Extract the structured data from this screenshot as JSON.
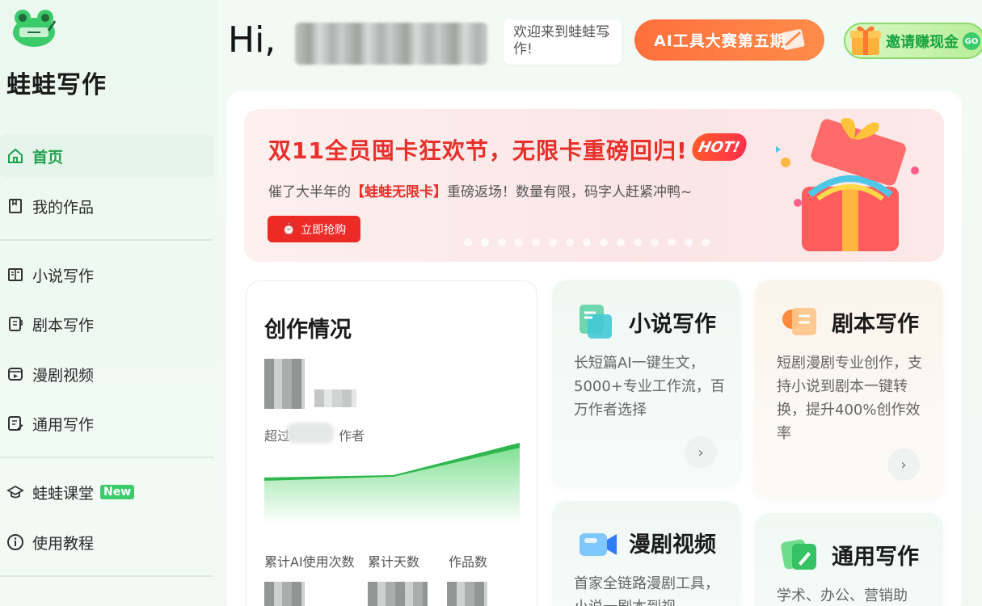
{
  "app": {
    "brand_name": "蛙蛙写作"
  },
  "sidebar": {
    "items": [
      {
        "label": "首页",
        "icon": "home-icon",
        "active": true
      },
      {
        "label": "我的作品",
        "icon": "book-icon"
      },
      {
        "label": "小说写作",
        "icon": "open-book-icon"
      },
      {
        "label": "剧本写作",
        "icon": "script-icon"
      },
      {
        "label": "漫剧视频",
        "icon": "video-icon"
      },
      {
        "label": "通用写作",
        "icon": "edit-doc-icon"
      },
      {
        "label": "蛙蛙课堂",
        "icon": "graduation-cap-icon",
        "badge": "New"
      },
      {
        "label": "使用教程",
        "icon": "info-icon"
      }
    ]
  },
  "header": {
    "greeting": "Hi,",
    "welcome_text": "欢迎来到蛙蛙写作!",
    "contest_label": "AI工具大赛第五期",
    "invite_label": "邀请赚现金",
    "invite_go": "GO"
  },
  "banner": {
    "title": "双11全员囤卡狂欢节，无限卡重磅回归!",
    "hot_badge": "HOT!",
    "subtitle_prefix": "催了大半年的",
    "subtitle_highlight": "【蛙蛙无限卡】",
    "subtitle_suffix": "重磅返场！数量有限，码字人赶紧冲鸭~",
    "button_label": "立即抢购"
  },
  "stats": {
    "title": "创作情况",
    "surpass_prefix": "超过",
    "surpass_suffix": "作者",
    "labels": [
      "累计AI使用次数",
      "累计天数",
      "作品数"
    ]
  },
  "features": [
    {
      "title": "小说写作",
      "desc": "长短篇AI一键生文，5000+专业工作流，百万作者选择",
      "icon": "novel-doc-icon"
    },
    {
      "title": "剧本写作",
      "desc": "短剧漫剧专业创作，支持小说到剧本一键转换，提升400%创作效率",
      "icon": "script-clipboard-icon"
    },
    {
      "title": "漫剧视频",
      "desc": "首家全链路漫剧工具，小说一剧本到视",
      "icon": "video-camera-icon"
    },
    {
      "title": "通用写作",
      "desc": "学术、办公、营销助",
      "icon": "pen-card-icon"
    }
  ],
  "colors": {
    "brand_green": "#21a04b",
    "banner_red": "#e8302b",
    "contest_orange": "#ff6f3c"
  }
}
